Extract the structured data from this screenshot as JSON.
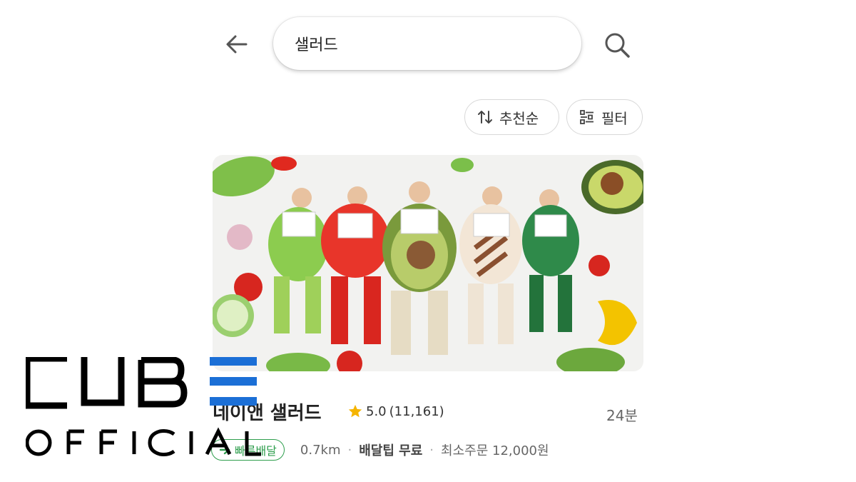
{
  "search": {
    "query": "샐러드"
  },
  "sort": {
    "label": "추천순"
  },
  "filter": {
    "label": "필터"
  },
  "store": {
    "name": "네이앤 샐러드",
    "rating": "5.0",
    "review_count": "(11,161)",
    "eta": "24분",
    "fast_delivery_label": "빠른배달",
    "distance": "0.7km",
    "delivery_tip": "배달팁 무료",
    "min_order": "최소주문 12,000원"
  },
  "watermark": {
    "line1": "CUBE",
    "line2": "OFFICIAL"
  },
  "colors": {
    "accent_green": "#2e9e4d",
    "star": "#f5b400",
    "cube_blue": "#1b6fd6"
  },
  "icons": [
    "back-arrow-icon",
    "search-icon",
    "sort-icon",
    "filter-icon",
    "star-icon",
    "fast-delivery-icon"
  ]
}
